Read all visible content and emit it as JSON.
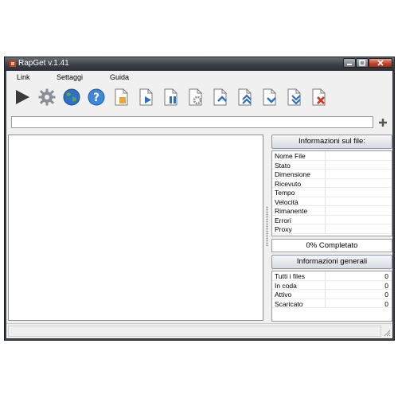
{
  "window": {
    "title": "RapGet v.1.41"
  },
  "menu": [
    "Link",
    "Settaggi",
    "Guida"
  ],
  "toolbar": [
    {
      "name": "start-button",
      "icon": "play-icon"
    },
    {
      "name": "settings-button",
      "icon": "gear-icon"
    },
    {
      "name": "web-button",
      "icon": "globe-icon"
    },
    {
      "name": "help-button",
      "icon": "help-icon"
    },
    {
      "name": "new-file-button",
      "icon": "file-new-icon"
    },
    {
      "name": "file-start-button",
      "icon": "file-play-icon"
    },
    {
      "name": "file-pause-button",
      "icon": "file-pause-icon"
    },
    {
      "name": "file-settings-button",
      "icon": "file-gear-icon"
    },
    {
      "name": "move-up-button",
      "icon": "file-arrow-up-icon"
    },
    {
      "name": "move-top-button",
      "icon": "file-double-up-icon"
    },
    {
      "name": "move-down-button",
      "icon": "file-arrow-down-icon"
    },
    {
      "name": "move-bottom-button",
      "icon": "file-double-down-icon"
    },
    {
      "name": "delete-button",
      "icon": "file-delete-icon"
    }
  ],
  "url_input": {
    "value": ""
  },
  "file_info": {
    "header": "Informazioni sul file:",
    "rows": [
      {
        "label": "Nome File",
        "value": ""
      },
      {
        "label": "Stato",
        "value": ""
      },
      {
        "label": "Dimensione",
        "value": ""
      },
      {
        "label": "Ricevuto",
        "value": ""
      },
      {
        "label": "Tempo",
        "value": ""
      },
      {
        "label": "Velocità",
        "value": ""
      },
      {
        "label": "Rimanente",
        "value": ""
      },
      {
        "label": "Errori",
        "value": ""
      },
      {
        "label": "Proxy",
        "value": ""
      }
    ]
  },
  "progress": {
    "text": "0% Completato",
    "value": 0
  },
  "general_info": {
    "header": "Informazioni generali",
    "rows": [
      {
        "label": "Tutti i files",
        "value": "0"
      },
      {
        "label": "In coda",
        "value": "0"
      },
      {
        "label": "Attivo",
        "value": "0"
      },
      {
        "label": "Scaricato",
        "value": "0"
      }
    ]
  },
  "colors": {
    "titlebar": "#3b3f46",
    "client": "#f0f0f0",
    "icon_blue": "#2f6fc4",
    "icon_folder": "#e8a73a",
    "close_red": "#c3452d"
  }
}
